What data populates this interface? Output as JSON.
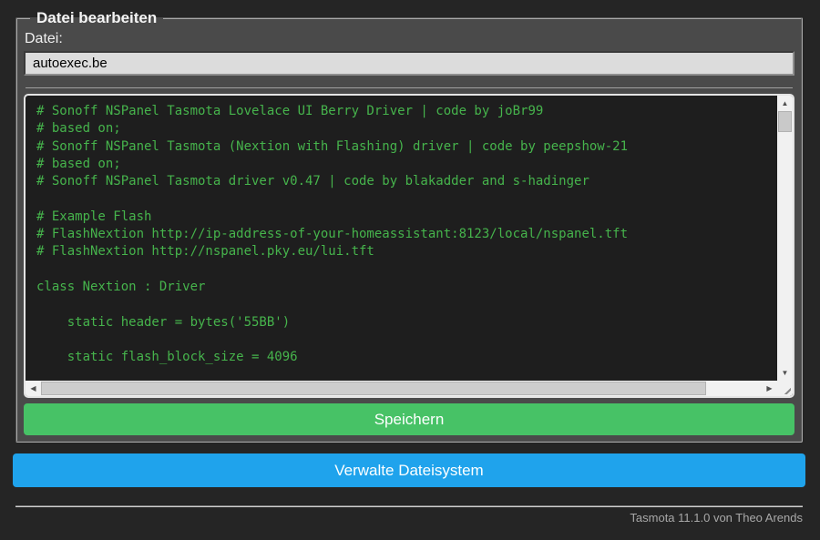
{
  "form": {
    "legend": "Datei bearbeiten",
    "file_label": "Datei:",
    "file_input_value": "autoexec.be",
    "save_button_label": "Speichern"
  },
  "editor": {
    "background": "#1e1e1e",
    "text_color": "#46b44c",
    "code_lines": [
      "# Sonoff NSPanel Tasmota Lovelace UI Berry Driver | code by joBr99",
      "# based on;",
      "# Sonoff NSPanel Tasmota (Nextion with Flashing) driver | code by peepshow-21",
      "# based on;",
      "# Sonoff NSPanel Tasmota driver v0.47 | code by blakadder and s-hadinger",
      "",
      "# Example Flash",
      "# FlashNextion http://ip-address-of-your-homeassistant:8123/local/nspanel.tft",
      "# FlashNextion http://nspanel.pky.eu/lui.tft",
      "",
      "class Nextion : Driver",
      "",
      "    static header = bytes('55BB')",
      "",
      "    static flash_block_size = 4096"
    ]
  },
  "buttons": {
    "manage_fs_label": "Verwalte Dateisystem",
    "save_color": "#47c266",
    "manage_color": "#1fa3ec"
  },
  "footer": {
    "text": "Tasmota 11.1.0 von Theo Arends"
  },
  "icons": {
    "up": "▲",
    "down": "▼",
    "left": "◀",
    "right": "▶"
  }
}
